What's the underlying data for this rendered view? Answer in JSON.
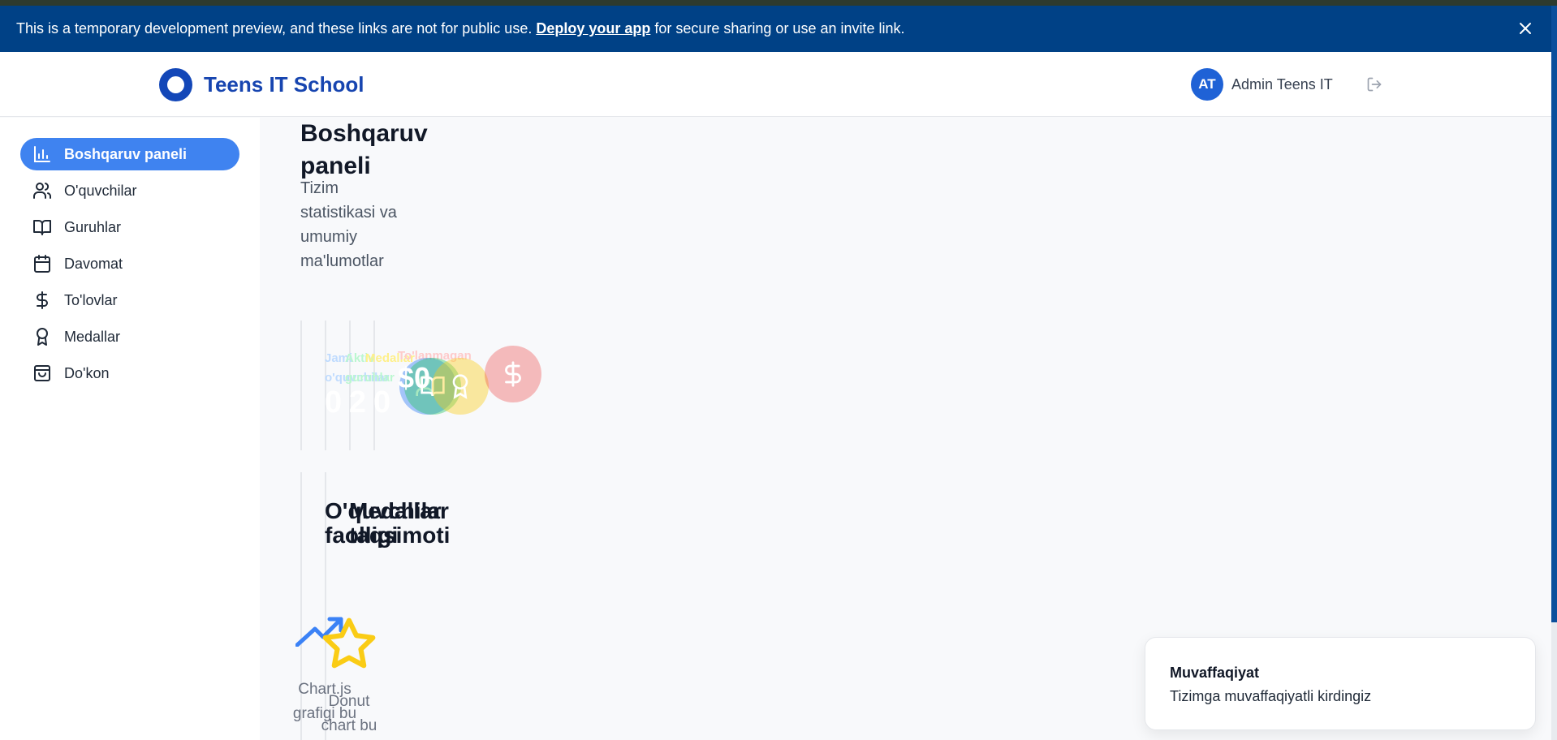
{
  "banner": {
    "text_before": "This is a temporary development preview, and these links are not for public use.",
    "link": "Deploy your app",
    "text_after": "for secure sharing or use an invite link.",
    "close_icon": "close-icon"
  },
  "header": {
    "brand": "Teens IT School",
    "avatar_initials": "AT",
    "user_name": "Admin Teens IT",
    "logout_icon": "logout-icon"
  },
  "sidebar": {
    "items": [
      {
        "label": "Boshqaruv paneli",
        "icon": "bar-chart-icon",
        "active": true
      },
      {
        "label": "O'quvchilar",
        "icon": "users-icon",
        "active": false
      },
      {
        "label": "Guruhlar",
        "icon": "book-open-icon",
        "active": false
      },
      {
        "label": "Davomat",
        "icon": "calendar-icon",
        "active": false
      },
      {
        "label": "To'lovlar",
        "icon": "dollar-icon",
        "active": false
      },
      {
        "label": "Medallar",
        "icon": "award-icon",
        "active": false
      },
      {
        "label": "Do'kon",
        "icon": "shopping-bag-icon",
        "active": false
      }
    ]
  },
  "main": {
    "title": "Boshqaruv paneli",
    "subtitle": "Tizim statistikasi va umumiy ma'lumotlar",
    "stats": [
      {
        "label": "Jami o'quvchilar",
        "value": "0",
        "color": "#3b82f6"
      },
      {
        "label": "Aktiv guruhlar",
        "value": "2",
        "color": "#22c55e"
      },
      {
        "label": "Medallar",
        "value": "0",
        "color": "#eab308"
      },
      {
        "label": "To'lanmagan",
        "value": "$0",
        "color": "#ef4444"
      }
    ],
    "cards": [
      {
        "title": "O'quvchilar faolligi",
        "note": "Chart.js grafigi bu"
      },
      {
        "title": "Medallar taqsimoti",
        "note": "Donut chart bu"
      }
    ]
  },
  "toast": {
    "title": "Muvaffaqiyat",
    "message": "Tizimga muvaffaqiyatli kirdingiz"
  }
}
